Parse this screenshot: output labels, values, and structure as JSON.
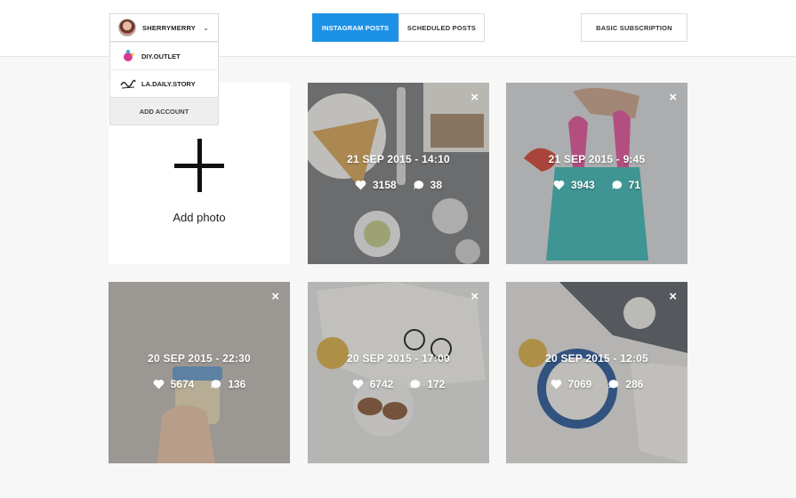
{
  "header": {
    "account": {
      "name": "SHERRYMERRY",
      "chevron": "⌄"
    },
    "accounts_menu": [
      {
        "label": "DIY.OUTLET",
        "icon": "diy-outlet-logo-icon"
      },
      {
        "label": "LA.DAILY.STORY",
        "icon": "la-daily-story-logo-icon"
      }
    ],
    "add_account_label": "ADD ACCOUNT",
    "tabs": [
      {
        "label": "INSTAGRAM POSTS",
        "active": true
      },
      {
        "label": "SCHEDULED POSTS",
        "active": false
      }
    ],
    "subscription_label": "BASIC SUBSCRIPTION"
  },
  "add_photo": {
    "label": "Add photo",
    "icon": "plus-icon"
  },
  "posts": [
    {
      "date": "21 SEP 2015 - 14:10",
      "likes": "3158",
      "comments": "38"
    },
    {
      "date": "21 SEP 2015 - 9:45",
      "likes": "3943",
      "comments": "71"
    },
    {
      "date": "20 SEP 2015 - 22:30",
      "likes": "5674",
      "comments": "136"
    },
    {
      "date": "20 SEP 2015 - 17:00",
      "likes": "6742",
      "comments": "172"
    },
    {
      "date": "20 SEP 2015 - 12:05",
      "likes": "7069",
      "comments": "286"
    }
  ],
  "close_glyph": "×",
  "colors": {
    "accent": "#1d91e6",
    "background": "#f7f7f7"
  }
}
